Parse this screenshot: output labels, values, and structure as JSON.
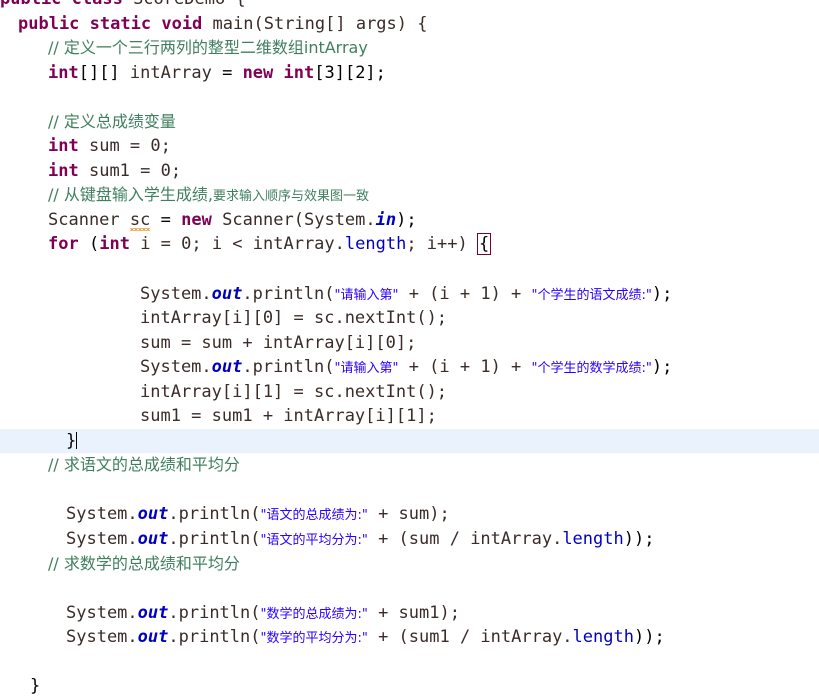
{
  "editor": {
    "language": "java",
    "file_name": "ScoreDemo.java",
    "colors": {
      "background": "#ffffff",
      "foreground": "#000000",
      "keyword": "#7f0055",
      "comment": "#3f7f5f",
      "string": "#2a00ff",
      "static_field": "#0000c0",
      "current_line_highlight": "#e9f2fd",
      "bracket_match_border": "#7f0026",
      "warning_squiggle": "#e8a33d"
    },
    "current_line_number": 19,
    "caret_after_text": "}"
  },
  "code": {
    "line_01_clipped": "public class ScoreDemo {",
    "line_02": {
      "kw_public": "public",
      "kw_static": "static",
      "kw_void": "void",
      "main": "main(String[] args) {"
    },
    "line_03_comment": "// 定义一个三行两列的整型二维数组intArray",
    "line_04": {
      "kw_int": "int",
      "brackets": "[][]",
      "var": "intArray",
      "eq": "=",
      "kw_new": "new",
      "kw_int2": "int",
      "dims": "[3][2];"
    },
    "line_06_comment": "// 定义总成绩变量",
    "line_07": {
      "kw": "int",
      "rest": "sum = 0;"
    },
    "line_08": {
      "kw": "int",
      "rest": "sum1 = 0;"
    },
    "line_09_comment_main": "// 从键盘输入学生成绩,",
    "line_09_comment_small": "要求输入顺序与效果图一致",
    "line_10": {
      "type": "Scanner",
      "var": "sc",
      "eq": "=",
      "kw_new": "new",
      "ctor": "Scanner(System.",
      "field": "in",
      "tail": ");"
    },
    "line_11": {
      "kw_for": "for",
      "open": "(",
      "kw_int": "int",
      "init": "i = 0; i < intArray.",
      "length": "length",
      "cond": "; i++) ",
      "brace": "{"
    },
    "line_13": {
      "prefix": "System.",
      "field": "out",
      "mid": ".println(",
      "str1": "\"请输入第\"",
      "plus1": " + (i + 1) + ",
      "str2": "\"个学生的语文成绩:\"",
      "tail": ");"
    },
    "line_14": {
      "text": "intArray[i][0] = sc.nextInt();"
    },
    "line_15": {
      "text": "sum = sum + intArray[i][0];"
    },
    "line_16": {
      "prefix": "System.",
      "field": "out",
      "mid": ".println(",
      "str1": "\"请输入第\"",
      "plus1": " + (i + 1) + ",
      "str2": "\"个学生的数学成绩:\"",
      "tail": ");"
    },
    "line_17": {
      "text": "intArray[i][1] = sc.nextInt();"
    },
    "line_18": {
      "text": "sum1 = sum1 + intArray[i][1];"
    },
    "line_19_current": {
      "brace": "}"
    },
    "line_20_comment": "// 求语文的总成绩和平均分",
    "line_22": {
      "prefix": "System.",
      "field": "out",
      "mid": ".println(",
      "str": "\"语文的总成绩为:\"",
      "tail": " + sum);"
    },
    "line_23": {
      "prefix": "System.",
      "field": "out",
      "mid": ".println(",
      "str": "\"语文的平均分为:\"",
      "mid2": " + (sum / intArray.",
      "length": "length",
      "tail": "));"
    },
    "line_24_comment": "// 求数学的总成绩和平均分",
    "line_26": {
      "prefix": "System.",
      "field": "out",
      "mid": ".println(",
      "str": "\"数学的总成绩为:\"",
      "tail": " + sum1);"
    },
    "line_27": {
      "prefix": "System.",
      "field": "out",
      "mid": ".println(",
      "str": "\"数学的平均分为:\"",
      "mid2": " + (sum1 / intArray.",
      "length": "length",
      "tail": "));"
    },
    "line_29_clipped": "}"
  }
}
